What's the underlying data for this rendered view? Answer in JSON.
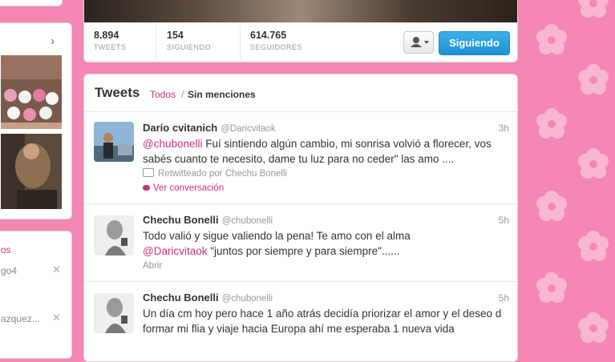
{
  "colors": {
    "accent": "#c7337c",
    "background": "#f487b4",
    "follow_button": "#2aa0dd"
  },
  "profile": {
    "stats": [
      {
        "value": "8.894",
        "label": "TWEETS"
      },
      {
        "value": "154",
        "label": "SIGUIENDO"
      },
      {
        "value": "614.765",
        "label": "SEGUIDORES"
      }
    ],
    "follow_label": "Siguiendo",
    "user_menu_icon": "user-dropdown-icon"
  },
  "tweets_header": {
    "title": "Tweets",
    "filter_all": "Todos",
    "separator": "/",
    "filter_no_mentions": "Sin menciones"
  },
  "tweets": [
    {
      "name": "Darío cvitanich",
      "handle": "@Daricvitaok",
      "time": "3h",
      "mention": "@chubonelli",
      "text": "Fuí sintiendo algún cambio, mi sonrisa volvió a florecer, vos sabés cuanto te necesito, dame tu luz para no ceder\" las amo ....",
      "retweet_by": "Retwitteado por Chechu Bonelli",
      "conversation": "Ver conversación"
    },
    {
      "name": "Chechu Bonelli",
      "handle": "@chubonelli",
      "time": "5h",
      "text_before": "Todo valió y sigue valiendo la pena! Te amo con el alma",
      "mention": "@Daricvitaok",
      "text_after": "\"juntos por siempre y para siempre\"......",
      "open": "Abrir"
    },
    {
      "name": "Chechu Bonelli",
      "handle": "@chubonelli",
      "time": "5h",
      "text": "Un día cm hoy pero hace 1 año atrás decidía priorizar el amor y el deseo d formar mi flia y viaje hacia Europa ahí me esperaba 1 nueva vida"
    }
  ],
  "left_suggestions": [
    {
      "text": "os"
    },
    {
      "text": "go4"
    },
    {
      "text": "azquez..."
    }
  ]
}
